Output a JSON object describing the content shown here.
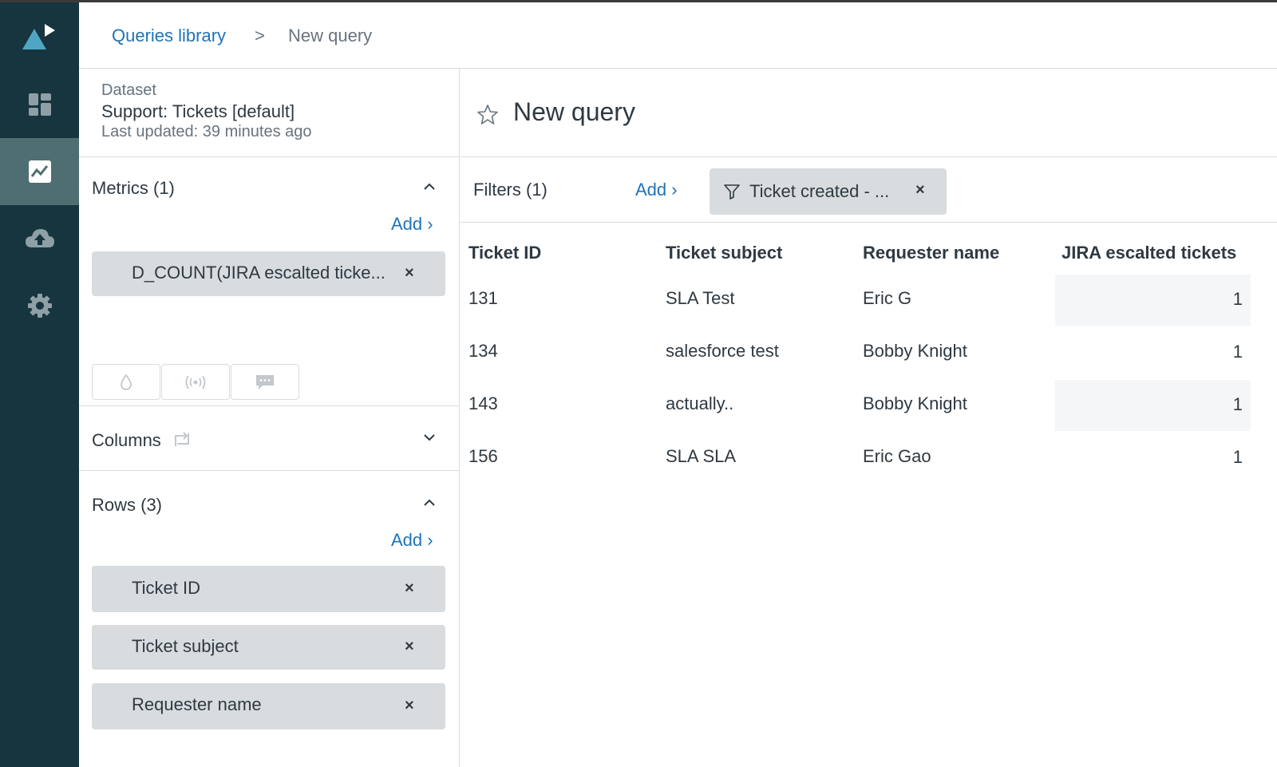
{
  "breadcrumb": {
    "library": "Queries library",
    "separator": ">",
    "current": "New query"
  },
  "dataset": {
    "label": "Dataset",
    "name": "Support: Tickets [default]",
    "updated": "Last updated: 39 minutes ago"
  },
  "metrics": {
    "title": "Metrics (1)",
    "add": "Add ›",
    "items": [
      {
        "label": "D_COUNT(JIRA escalted ticke...",
        "remove": "×"
      }
    ]
  },
  "visualization_buttons": [
    "drop-icon",
    "broadcast-icon",
    "comment-icon"
  ],
  "columns": {
    "title": "Columns"
  },
  "rows_section": {
    "title": "Rows (3)",
    "add": "Add ›",
    "items": [
      {
        "label": "Ticket ID",
        "remove": "×"
      },
      {
        "label": "Ticket subject",
        "remove": "×"
      },
      {
        "label": "Requester name",
        "remove": "×"
      }
    ]
  },
  "main": {
    "title": "New query",
    "filters_label": "Filters (1)",
    "filters_add": "Add ›",
    "filter_pill": {
      "label": "Ticket created - ...",
      "remove": "×"
    }
  },
  "table": {
    "headers": [
      "Ticket ID",
      "Ticket subject",
      "Requester name",
      "JIRA escalted tickets"
    ],
    "rows": [
      [
        "131",
        "SLA Test",
        "Eric G",
        "1"
      ],
      [
        "134",
        "salesforce test",
        "Bobby Knight",
        "1"
      ],
      [
        "143",
        "actually..",
        "Bobby Knight",
        "1"
      ],
      [
        "156",
        "SLA SLA",
        "Eric Gao",
        "1"
      ]
    ]
  },
  "colors": {
    "rail": "#17353e",
    "rail_active": "#4f6e72",
    "link": "#1f73b7",
    "pill": "#d8dcde",
    "logo": "#4fa6c4"
  },
  "rail_icons": [
    "dashboard-icon",
    "reports-icon",
    "upload-icon",
    "settings-icon"
  ]
}
